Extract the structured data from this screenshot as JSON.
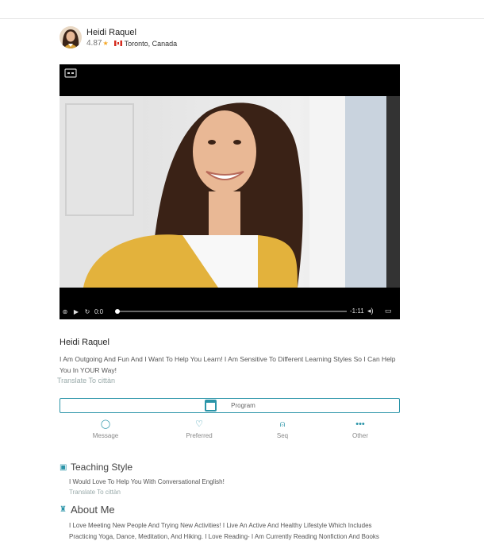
{
  "tutor": {
    "name": "Heidi Raquel",
    "rating": "4.87",
    "location": "Toronto, Canada"
  },
  "video": {
    "current_time": "0:0",
    "remaining_time": "-1:11"
  },
  "bio": {
    "text": "I Am Outgoing And Fun And I Want To Help You Learn! I Am Sensitive To Different Learning Styles So I Can Help You In YOUR Way!",
    "translate": "Translate To cittàn"
  },
  "program_button": {
    "label": "Program"
  },
  "actions": [
    {
      "label": "Message",
      "icon": "chat-bubble-icon"
    },
    {
      "label": "Preferred",
      "icon": "heart-icon"
    },
    {
      "label": "Seq",
      "icon": "bell-icon"
    },
    {
      "label": "Other",
      "icon": "more-dots-icon"
    }
  ],
  "teaching_style": {
    "title": "Teaching Style",
    "text": "I Would Love To Help You With Conversational English!",
    "translate": "Translate To cittàn"
  },
  "about_me": {
    "title": "About Me",
    "text": "I Love Meeting New People And Trying New Activities! I Live An Active And Healthy Lifestyle Which Includes Practicing Yoga, Dance, Meditation, And Hiking. I Love Reading- I Am Currently Reading Nonfiction And Books"
  },
  "colors": {
    "accent": "#2a94a8",
    "star": "#f5a623"
  }
}
